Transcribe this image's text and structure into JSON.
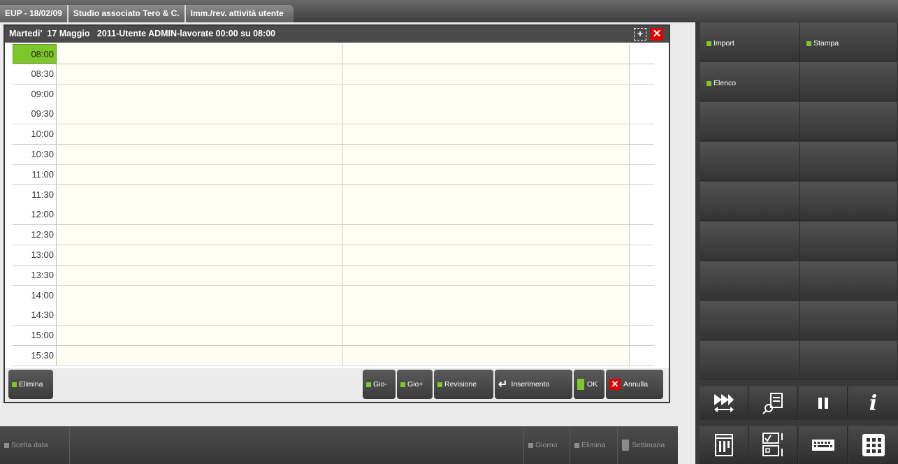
{
  "tabs": [
    {
      "label": "EUP - 18/02/09"
    },
    {
      "label": "Studio associato Tero & C."
    },
    {
      "label": "Imm./rev. attività utente"
    }
  ],
  "dialog": {
    "title": "Martedi'  17 Maggio   2011-Utente ADMIN-lavorate 00:00 su 08:00",
    "expand_icon": "expand-icon",
    "close_icon": "close-icon"
  },
  "agenda": {
    "slots": [
      "08:00",
      "08:30",
      "09:00",
      "09:30",
      "10:00",
      "10:30",
      "11:00",
      "11:30",
      "12:00",
      "12:30",
      "13:00",
      "13:30",
      "14:00",
      "14:30",
      "15:00",
      "15:30"
    ],
    "selected_slot": "08:00"
  },
  "dialog_buttons": {
    "elimina": "Elimina",
    "gio_minus": "Gio-",
    "gio_plus": "Gio+",
    "revisione": "Revisione",
    "inserimento": "Inserimento",
    "ok": "OK",
    "annulla": "Annulla"
  },
  "bottom_toolbar": {
    "scelta_data": "Scelta data",
    "giorno": "Giorno",
    "elimina": "Elimina",
    "settimana": "Settimana"
  },
  "right_panel": {
    "import": "Import",
    "stampa": "Stampa",
    "elenco": "Elenco",
    "icons": [
      "fast-forward-swap-icon",
      "document-search-icon",
      "pause-icon",
      "info-icon",
      "calendar-icon",
      "records-icon",
      "keyboard-icon",
      "grid-icon"
    ]
  },
  "colors": {
    "accent_green": "#7dc72a",
    "close_red": "#e20000",
    "dark_bg": "#3a3a3a"
  }
}
